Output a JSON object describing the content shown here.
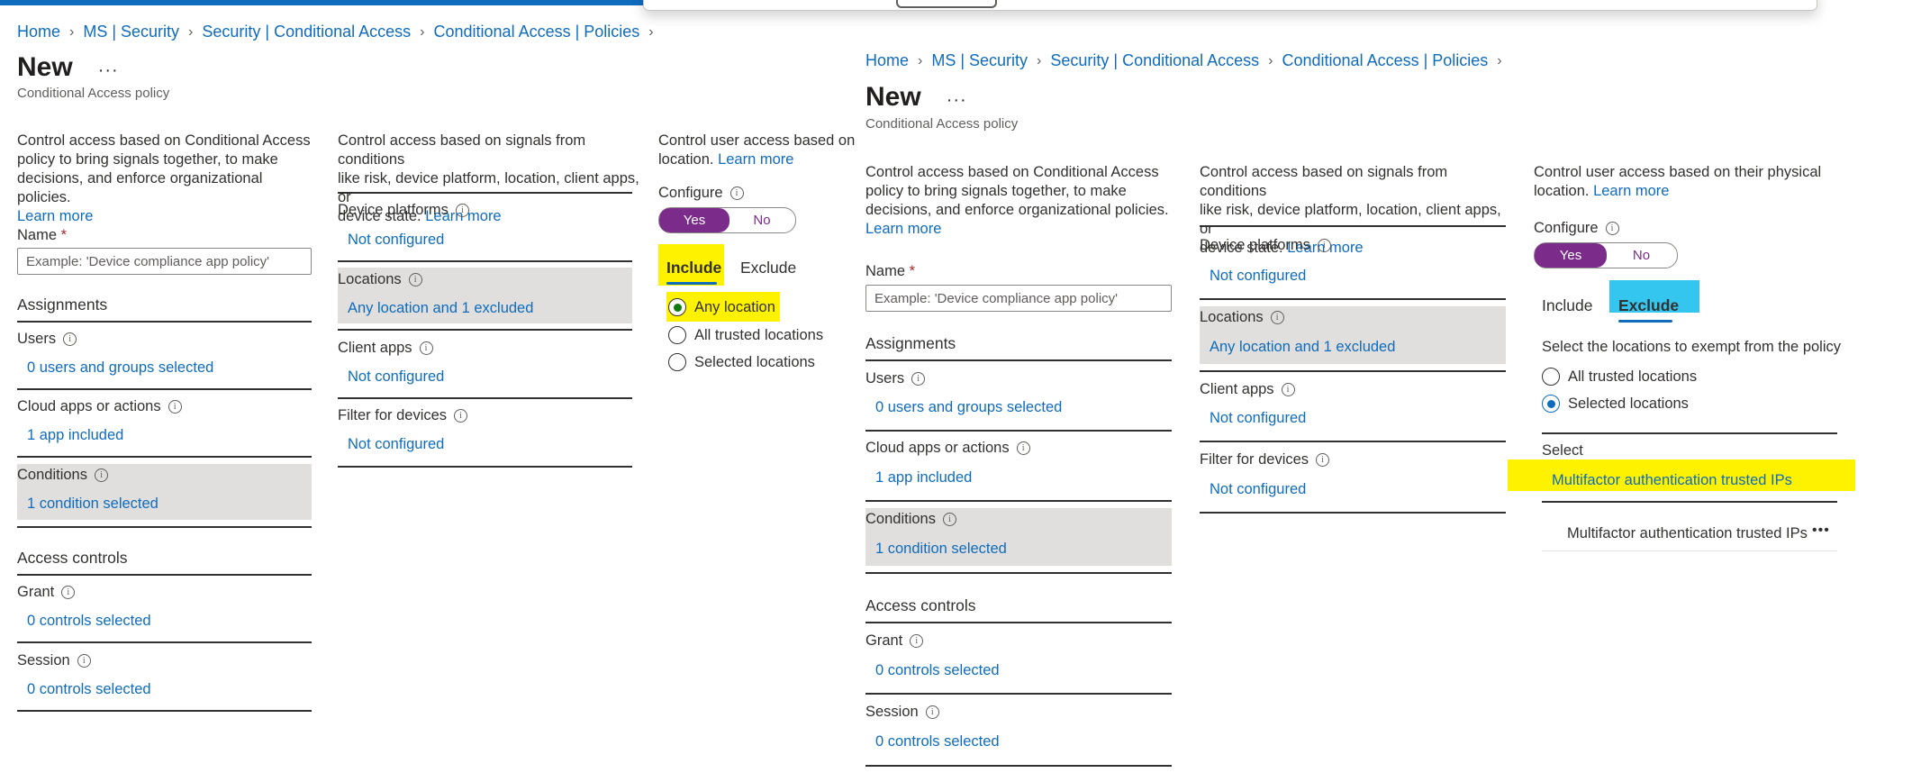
{
  "left": {
    "breadcrumb": [
      "Home",
      "MS | Security",
      "Security | Conditional Access",
      "Conditional Access | Policies"
    ],
    "title": "New",
    "more": "···",
    "subtitle": "Conditional Access policy",
    "intro_lines": [
      "Control access based on Conditional Access",
      "policy to bring signals together, to make",
      "decisions, and enforce organizational policies."
    ],
    "intro_link": "Learn more",
    "name_label": "Name",
    "name_required": "*",
    "name_placeholder": "Example: 'Device compliance app policy'",
    "assignments": "Assignments",
    "users_label": "Users",
    "users_value": "0 users and groups selected",
    "cloud_label": "Cloud apps or actions",
    "cloud_value": "1 app included",
    "conditions_label": "Conditions",
    "conditions_value": "1 condition selected",
    "access_controls": "Access controls",
    "grant_label": "Grant",
    "grant_value": "0 controls selected",
    "session_label": "Session",
    "session_value": "0 controls selected",
    "cond_desc_lines": [
      "Control access based on signals from conditions",
      "like risk, device platform, location, client apps, or"
    ],
    "cond_desc_last": "device state.",
    "cond_link": "Learn more",
    "device_platforms_label": "Device platforms",
    "device_platforms_value": "Not configured",
    "locations_label": "Locations",
    "locations_value": "Any location and 1 excluded",
    "client_apps_label": "Client apps",
    "client_apps_value": "Not configured",
    "filter_label": "Filter for devices",
    "filter_value": "Not configured",
    "loc_desc_line1": "Control user access based on the",
    "loc_desc_line2": "location.",
    "loc_link": "Learn more",
    "configure_label": "Configure",
    "toggle_yes": "Yes",
    "toggle_no": "No",
    "tab_include": "Include",
    "tab_exclude": "Exclude",
    "radio_any": "Any location",
    "radio_trusted": "All trusted locations",
    "radio_selected": "Selected locations"
  },
  "right": {
    "breadcrumb": [
      "Home",
      "MS | Security",
      "Security | Conditional Access",
      "Conditional Access | Policies"
    ],
    "title": "New",
    "more": "···",
    "subtitle": "Conditional Access policy",
    "intro_lines": [
      "Control access based on Conditional Access",
      "policy to bring signals together, to make",
      "decisions, and enforce organizational policies."
    ],
    "intro_link": "Learn more",
    "name_label": "Name",
    "name_required": "*",
    "name_placeholder": "Example: 'Device compliance app policy'",
    "assignments": "Assignments",
    "users_label": "Users",
    "users_value": "0 users and groups selected",
    "cloud_label": "Cloud apps or actions",
    "cloud_value": "1 app included",
    "conditions_label": "Conditions",
    "conditions_value": "1 condition selected",
    "access_controls": "Access controls",
    "grant_label": "Grant",
    "grant_value": "0 controls selected",
    "session_label": "Session",
    "session_value": "0 controls selected",
    "cond_desc_lines": [
      "Control access based on signals from conditions",
      "like risk, device platform, location, client apps, or"
    ],
    "cond_desc_last": "device state.",
    "cond_link": "Learn more",
    "device_platforms_label": "Device platforms",
    "device_platforms_value": "Not configured",
    "locations_label": "Locations",
    "locations_value": "Any location and 1 excluded",
    "client_apps_label": "Client apps",
    "client_apps_value": "Not configured",
    "filter_label": "Filter for devices",
    "filter_value": "Not configured",
    "loc_desc_line1": "Control user access based on their physical",
    "loc_desc_line2": "location.",
    "loc_link": "Learn more",
    "configure_label": "Configure",
    "toggle_yes": "Yes",
    "toggle_no": "No",
    "tab_include": "Include",
    "tab_exclude": "Exclude",
    "exempt_text": "Select the locations to exempt from the policy",
    "radio_trusted": "All trusted locations",
    "radio_selected": "Selected locations",
    "select_label": "Select",
    "select_value": "Multifactor authentication trusted IPs",
    "selected_item": "Multifactor authentication trusted IPs",
    "selected_item_more": "•••"
  },
  "colors": {
    "link": "#0f6cbd",
    "toggle_on": "#7b2c8b",
    "highlight_yellow": "#fff200",
    "highlight_cyan": "#35c6f0",
    "shade": "#e1dfdd"
  }
}
